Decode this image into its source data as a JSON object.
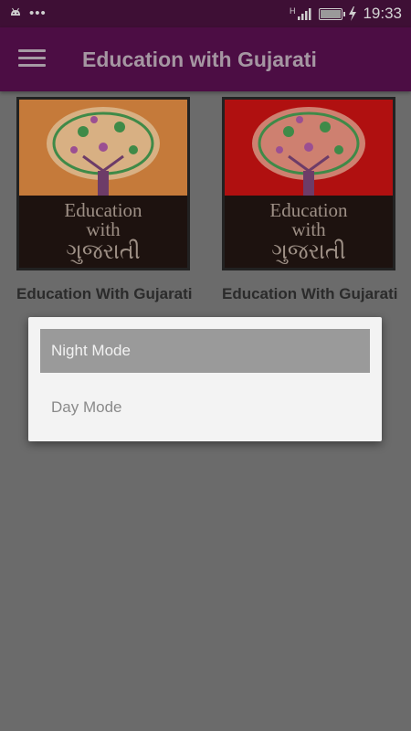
{
  "status_bar": {
    "time": "19:33",
    "network": "H",
    "battery_level": 1.0
  },
  "app_bar": {
    "title": "Education with Gujarati"
  },
  "cards": [
    {
      "label": "Education With Gujarati",
      "image_text": [
        "Education",
        "with",
        "ગુજરાતી"
      ],
      "background": "#c57a3a"
    },
    {
      "label": "Education With Gujarati",
      "image_text": [
        "Education",
        "with",
        "ગુજરાતી"
      ],
      "background": "#b01010"
    }
  ],
  "dialog": {
    "options": [
      {
        "label": "Night Mode",
        "selected": true
      },
      {
        "label": "Day Mode",
        "selected": false
      }
    ]
  },
  "colors": {
    "status_bar": "#3e0f35",
    "app_bar": "#4c0d44",
    "scrim_background": "#6b6b6b"
  }
}
